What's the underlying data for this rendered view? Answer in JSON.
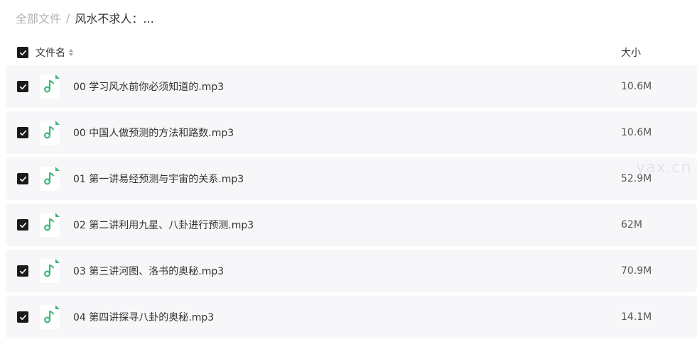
{
  "breadcrumb": {
    "root": "全部文件",
    "separator": "/",
    "current": "风水不求人：..."
  },
  "header": {
    "name_label": "文件名",
    "size_label": "大小"
  },
  "files": [
    {
      "name": "00 学习风水前你必须知道的.mp3",
      "size": "10.6M"
    },
    {
      "name": "00 中国人做预测的方法和路数.mp3",
      "size": "10.6M"
    },
    {
      "name": "01 第一讲易经预测与宇宙的关系.mp3",
      "size": "52.9M"
    },
    {
      "name": "02 第二讲利用九星、八卦进行预测.mp3",
      "size": "62M"
    },
    {
      "name": "03 第三讲河图、洛书的奥秘.mp3",
      "size": "70.9M"
    },
    {
      "name": "04 第四讲探寻八卦的奥秘.mp3",
      "size": "14.1M"
    }
  ],
  "icons": {
    "checkbox": "checkbox-checked-icon",
    "sort": "sort-icon",
    "file_type": "audio-file-icon"
  },
  "colors": {
    "audio_accent": "#3cb879",
    "checkbox_fill": "#1a1a1a",
    "row_background": "#f7f7f9"
  },
  "watermark": "yax.cn"
}
